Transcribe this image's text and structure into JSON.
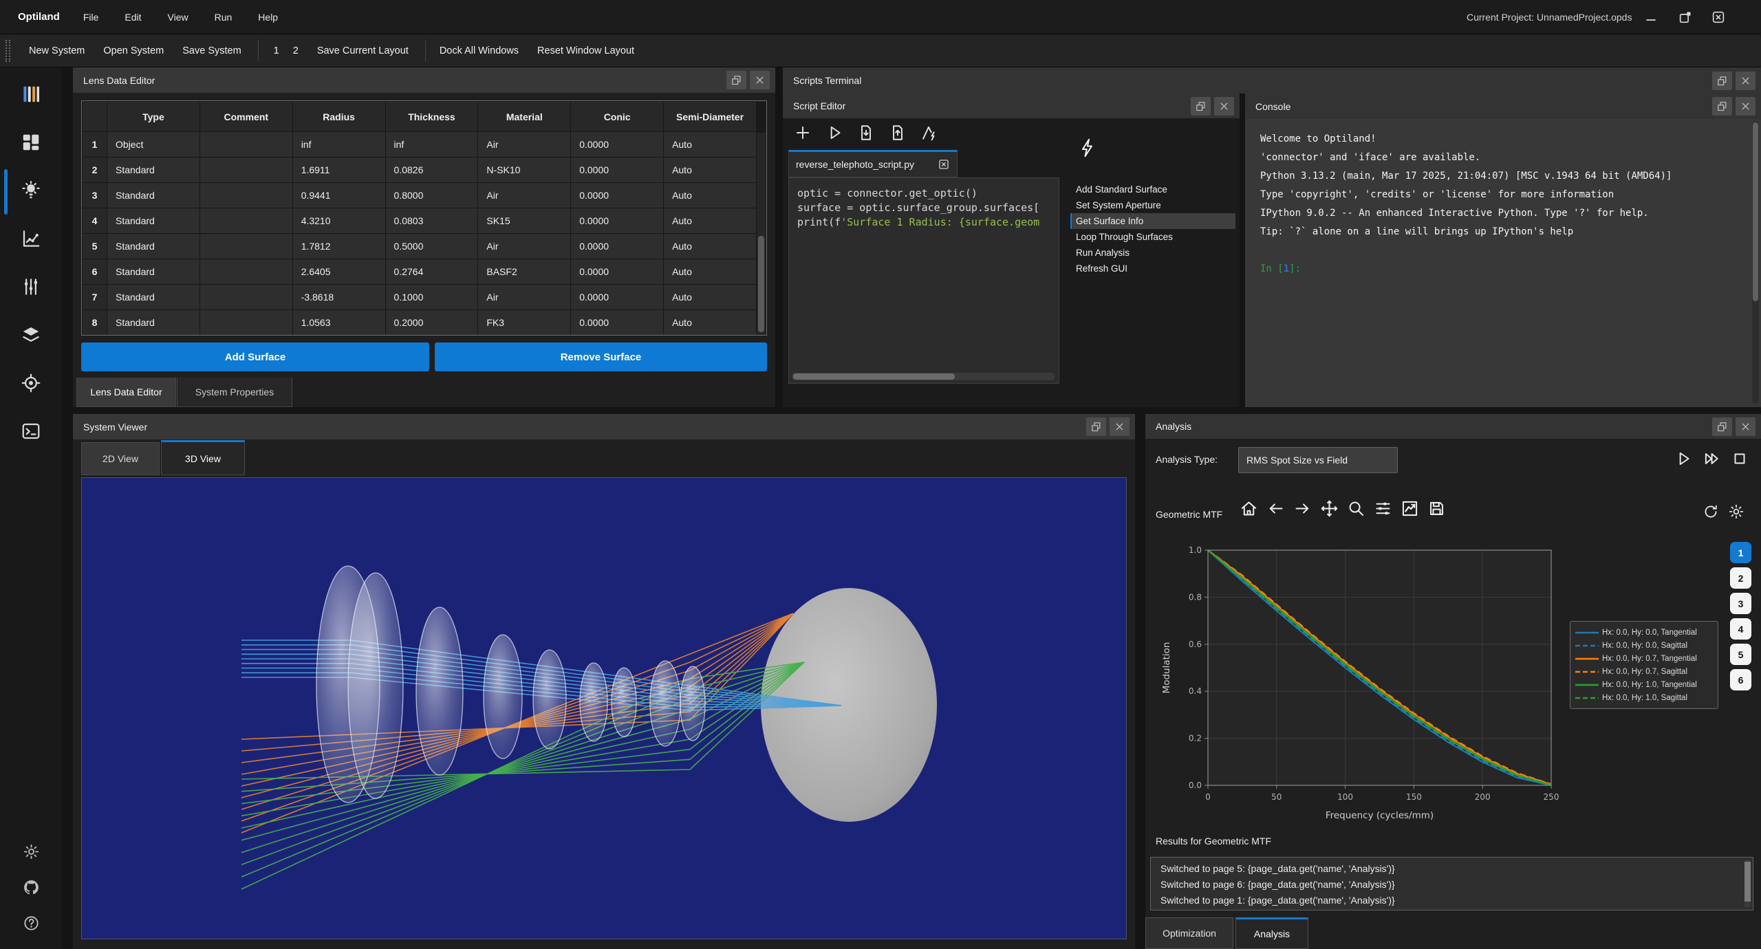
{
  "window": {
    "app_title": "Optiland",
    "project_label": "Current Project: UnnamedProject.opds",
    "window_icons": [
      "minimize-icon",
      "restore-icon",
      "close-icon"
    ]
  },
  "menu": {
    "items": [
      "File",
      "Edit",
      "View",
      "Run",
      "Help"
    ]
  },
  "toolbar": {
    "new_system": "New System",
    "open_system": "Open System",
    "save_system": "Save System",
    "layout_1": "1",
    "layout_2": "2",
    "save_layout": "Save Current Layout",
    "dock_all": "Dock All Windows",
    "reset_layout": "Reset Window Layout"
  },
  "sidebar": {
    "top_icons": [
      {
        "name": "columns-icon",
        "active": false
      },
      {
        "name": "dashboard-icon",
        "active": false
      },
      {
        "name": "lightbulb-icon",
        "active": true
      },
      {
        "name": "scatter-chart-icon",
        "active": false
      },
      {
        "name": "sliders-icon",
        "active": false
      },
      {
        "name": "layers-icon",
        "active": false
      },
      {
        "name": "target-icon",
        "active": false
      },
      {
        "name": "terminal-icon",
        "active": false
      }
    ],
    "bottom_icons": [
      {
        "name": "gear-icon"
      },
      {
        "name": "github-icon"
      },
      {
        "name": "help-icon"
      }
    ]
  },
  "lens_editor": {
    "title": "Lens Data Editor",
    "columns": [
      "",
      "Type",
      "Comment",
      "Radius",
      "Thickness",
      "Material",
      "Conic",
      "Semi-Diameter"
    ],
    "rows": [
      [
        "1",
        "Object",
        "",
        "inf",
        "inf",
        "Air",
        "0.0000",
        "Auto"
      ],
      [
        "2",
        "Standard",
        "",
        "1.6911",
        "0.0826",
        "N-SK10",
        "0.0000",
        "Auto"
      ],
      [
        "3",
        "Standard",
        "",
        "0.9441",
        "0.8000",
        "Air",
        "0.0000",
        "Auto"
      ],
      [
        "4",
        "Standard",
        "",
        "4.3210",
        "0.0803",
        "SK15",
        "0.0000",
        "Auto"
      ],
      [
        "5",
        "Standard",
        "",
        "1.7812",
        "0.5000",
        "Air",
        "0.0000",
        "Auto"
      ],
      [
        "6",
        "Standard",
        "",
        "2.6405",
        "0.2764",
        "BASF2",
        "0.0000",
        "Auto"
      ],
      [
        "7",
        "Standard",
        "",
        "-3.8618",
        "0.1000",
        "Air",
        "0.0000",
        "Auto"
      ],
      [
        "8",
        "Standard",
        "",
        "1.0563",
        "0.2000",
        "FK3",
        "0.0000",
        "Auto"
      ]
    ],
    "add_button": "Add Surface",
    "remove_button": "Remove Surface",
    "tabs": [
      {
        "label": "Lens Data Editor",
        "selected": true
      },
      {
        "label": "System Properties",
        "selected": false
      }
    ]
  },
  "system_viewer": {
    "title": "System Viewer",
    "tabs": [
      {
        "label": "2D View",
        "selected": false
      },
      {
        "label": "3D View",
        "selected": true
      }
    ]
  },
  "scripts_terminal": {
    "title": "Scripts Terminal"
  },
  "script_editor": {
    "title": "Script Editor",
    "toolbar_icons": [
      "plus-icon",
      "run-icon",
      "file-import-icon",
      "file-export-icon",
      "lint-icon"
    ],
    "tab_label": "reverse_telephoto_script.py",
    "code_lines": [
      [
        {
          "t": "optic = connector.get_optic()",
          "c": "code"
        }
      ],
      [
        {
          "t": "surface = optic.surface_group.surfaces[",
          "c": "code"
        }
      ],
      [
        {
          "t": "print(f",
          "c": "code"
        },
        {
          "t": "'Surface 1 Radius: {surface.geom",
          "c": "str"
        }
      ]
    ],
    "commands": [
      "Add Standard Surface",
      "Set System Aperture",
      "Get Surface Info",
      "Loop Through Surfaces",
      "Run Analysis",
      "Refresh GUI"
    ],
    "selected_command": 2
  },
  "console": {
    "title": "Console",
    "lines": [
      "Welcome to Optiland!",
      "'connector' and 'iface' are available.",
      "Python 3.13.2 (main, Mar 17 2025, 21:04:07) [MSC v.1943 64 bit (AMD64)]",
      "Type 'copyright', 'credits' or 'license' for more information",
      "IPython 9.0.2 -- An enhanced Interactive Python. Type '?' for help.",
      "Tip: `?` alone on a line will brings up IPython's help",
      ""
    ],
    "prompt_prefix": "In [",
    "prompt_num": "1",
    "prompt_suffix": "]:"
  },
  "analysis": {
    "title": "Analysis",
    "type_label": "Analysis Type:",
    "type_value": "RMS Spot Size vs Field",
    "run_icons": [
      "run-icon",
      "fast-forward-icon",
      "stop-icon"
    ],
    "mtf_title": "Geometric MTF",
    "mtf_toolbar": [
      "home-icon",
      "back-icon",
      "forward-icon",
      "pan-icon",
      "zoom-icon",
      "subplots-icon",
      "plot-icon",
      "save-icon"
    ],
    "mtf_right_icons": [
      "refresh-icon",
      "gear-icon"
    ],
    "pages": [
      "1",
      "2",
      "3",
      "4",
      "5",
      "6"
    ],
    "active_page": 0,
    "results_label": "Results for Geometric MTF",
    "messages": [
      "Switched to page 5: {page_data.get('name', 'Analysis')}",
      "Switched to page 6: {page_data.get('name', 'Analysis')}",
      "Switched to page 1: {page_data.get('name', 'Analysis')}"
    ],
    "tabs": [
      {
        "label": "Optimization",
        "selected": false
      },
      {
        "label": "Analysis",
        "selected": true
      }
    ]
  },
  "chart_data": {
    "type": "line",
    "title": "Geometric MTF",
    "xlabel": "Frequency (cycles/mm)",
    "ylabel": "Modulation",
    "xlim": [
      0,
      250
    ],
    "ylim": [
      0.0,
      1.0
    ],
    "xticks": [
      0,
      50,
      100,
      150,
      200,
      250
    ],
    "yticks": [
      0.0,
      0.2,
      0.4,
      0.6,
      0.8,
      1.0
    ],
    "grid": true,
    "legend_position": "right",
    "x": [
      0,
      25,
      50,
      75,
      100,
      125,
      150,
      175,
      200,
      225,
      250
    ],
    "series": [
      {
        "name": "Hx: 0.0, Hy: 0.0, Tangential",
        "color": "#1f77b4",
        "dash": "solid",
        "values": [
          1.0,
          0.868,
          0.742,
          0.619,
          0.5,
          0.386,
          0.28,
          0.183,
          0.099,
          0.033,
          0.0
        ]
      },
      {
        "name": "Hx: 0.0, Hy: 0.0, Sagittal",
        "color": "#1f77b4",
        "dash": "dashed",
        "values": [
          1.0,
          0.873,
          0.747,
          0.624,
          0.505,
          0.391,
          0.285,
          0.188,
          0.104,
          0.037,
          0.0
        ]
      },
      {
        "name": "Hx: 0.0, Hy: 0.7, Tangential",
        "color": "#ff7f0e",
        "dash": "solid",
        "values": [
          1.0,
          0.889,
          0.765,
          0.642,
          0.523,
          0.409,
          0.303,
          0.206,
          0.12,
          0.05,
          0.004
        ]
      },
      {
        "name": "Hx: 0.0, Hy: 0.7, Sagittal",
        "color": "#ff7f0e",
        "dash": "dashed",
        "values": [
          1.0,
          0.893,
          0.769,
          0.646,
          0.527,
          0.413,
          0.307,
          0.21,
          0.124,
          0.053,
          0.005
        ]
      },
      {
        "name": "Hx: 0.0, Hy: 1.0, Tangential",
        "color": "#2ca02c",
        "dash": "solid",
        "values": [
          1.0,
          0.879,
          0.755,
          0.632,
          0.513,
          0.399,
          0.293,
          0.196,
          0.111,
          0.043,
          0.001
        ]
      },
      {
        "name": "Hx: 0.0, Hy: 1.0, Sagittal",
        "color": "#2ca02c",
        "dash": "dashed",
        "values": [
          1.0,
          0.883,
          0.759,
          0.636,
          0.517,
          0.403,
          0.297,
          0.2,
          0.115,
          0.046,
          0.002
        ]
      }
    ]
  },
  "colors": {
    "accent": "#1479d0",
    "viewport_bg": "#1b2377",
    "ray_blue": "#4aa0dc",
    "ray_orange": "#e8812f",
    "ray_green": "#43b14b",
    "button_blue": "#0e7ad3"
  }
}
